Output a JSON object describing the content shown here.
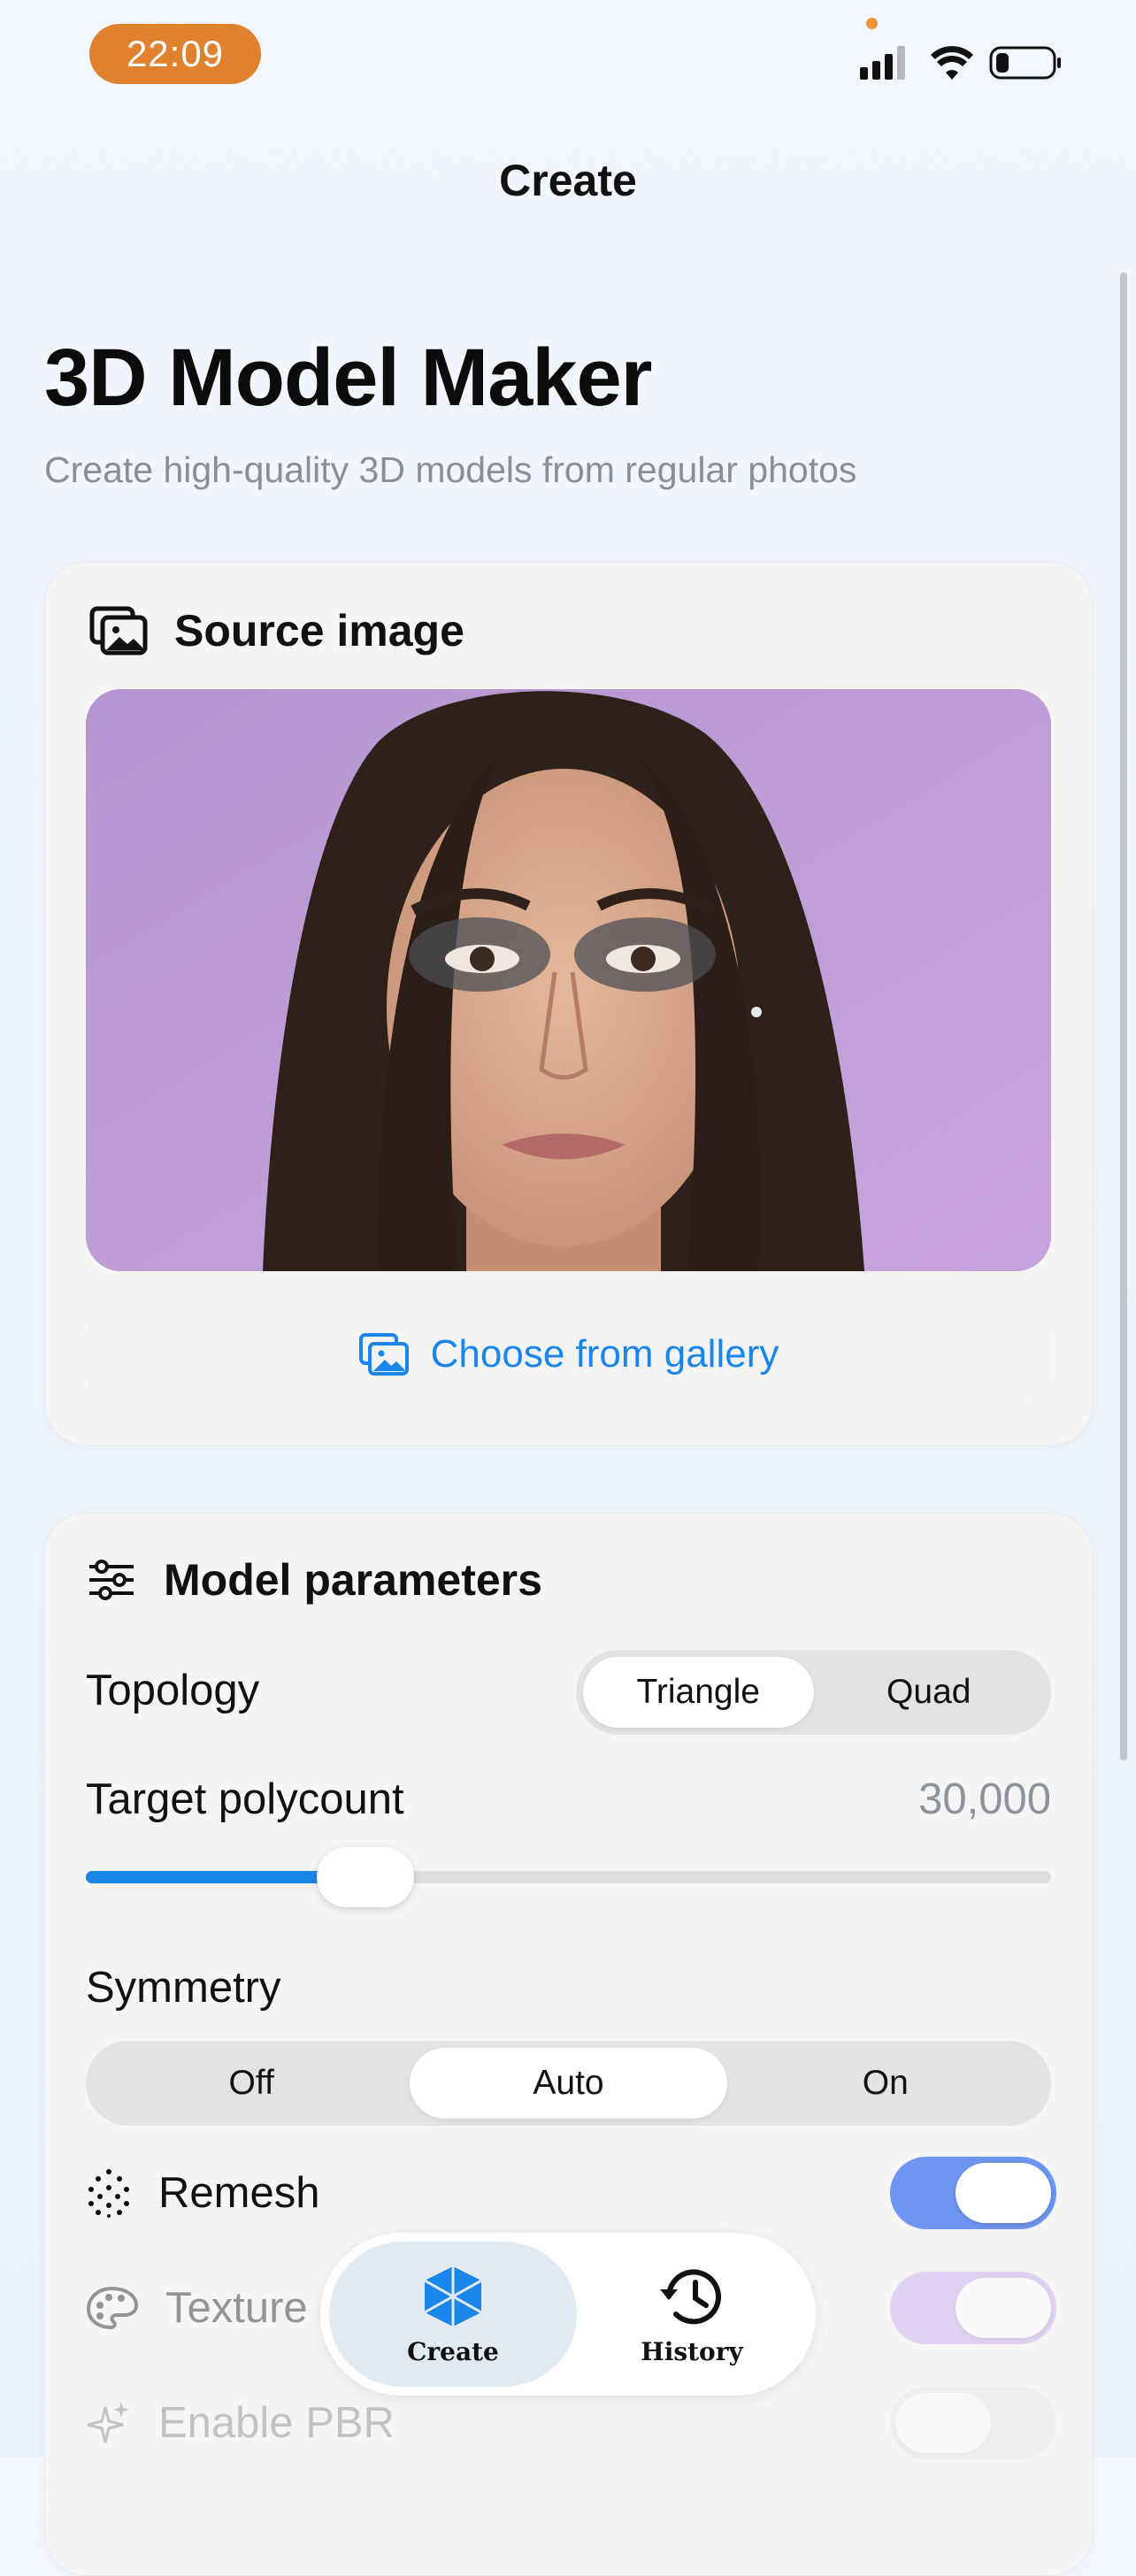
{
  "status_bar": {
    "time": "22:09"
  },
  "nav": {
    "title": "Create"
  },
  "header": {
    "title": "3D Model Maker",
    "subtitle": "Create high-quality 3D models from regular photos"
  },
  "source_card": {
    "title": "Source image",
    "gallery_button": "Choose from gallery"
  },
  "params_card": {
    "title": "Model parameters",
    "topology": {
      "label": "Topology",
      "options": [
        "Triangle",
        "Quad"
      ],
      "selected": "Triangle"
    },
    "polycount": {
      "label": "Target polycount",
      "value": "30,000",
      "slider_fraction": 0.29
    },
    "symmetry": {
      "label": "Symmetry",
      "options": [
        "Off",
        "Auto",
        "On"
      ],
      "selected": "Auto"
    },
    "remesh": {
      "label": "Remesh",
      "on": true
    },
    "texture": {
      "label": "Texture",
      "on": true
    },
    "pbr": {
      "label": "Enable PBR",
      "on": false
    }
  },
  "tabbar": {
    "create_label": "Create",
    "history_label": "History"
  },
  "colors": {
    "accent": "#1a86ea",
    "time_pill": "#e0822d",
    "remesh_toggle": "#6d96f0",
    "texture_toggle": "#c7a0f0"
  }
}
